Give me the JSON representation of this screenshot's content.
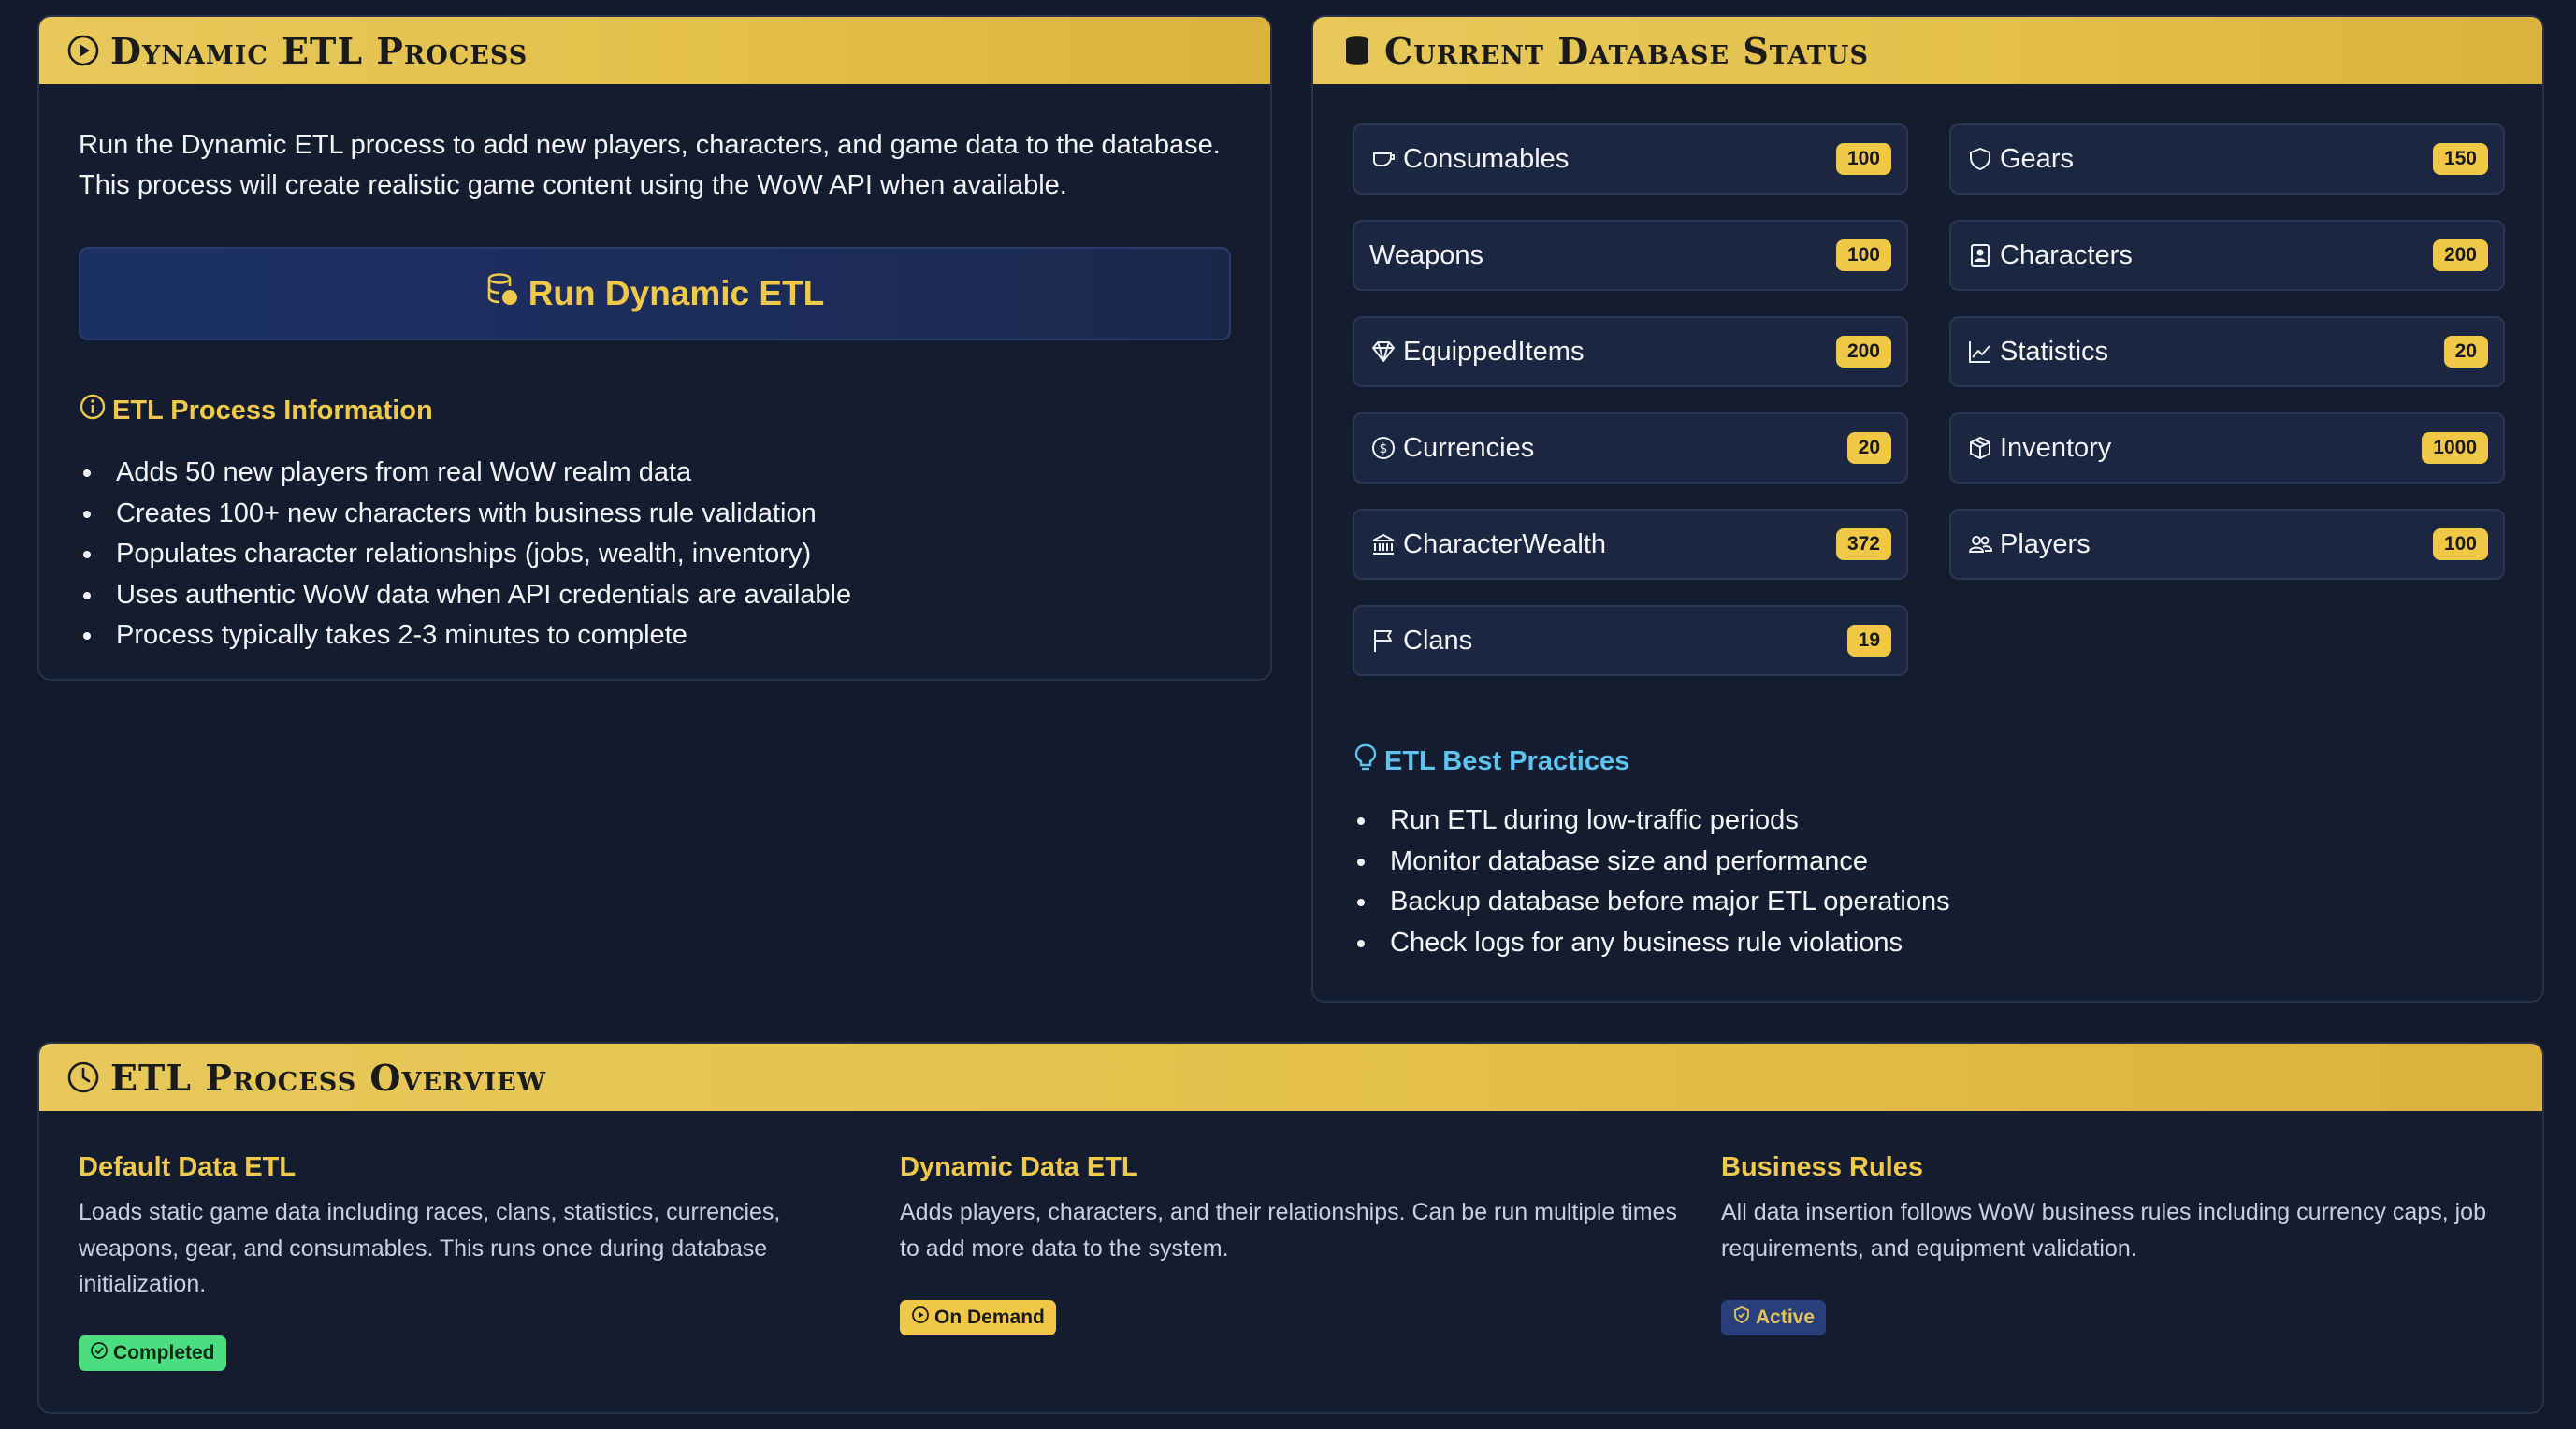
{
  "etl": {
    "title": "Dynamic ETL Process",
    "description": "Run the Dynamic ETL process to add new players, characters, and game data to the database. This process will create realistic game content using the WoW API when available.",
    "run_button": "Run Dynamic ETL",
    "info_title": "ETL Process Information",
    "info_items": [
      "Adds 50 new players from real WoW realm data",
      "Creates 100+ new characters with business rule validation",
      "Populates character relationships (jobs, wealth, inventory)",
      "Uses authentic WoW data when API credentials are available",
      "Process typically takes 2-3 minutes to complete"
    ]
  },
  "db": {
    "title": "Current Database Status",
    "stats": [
      {
        "label": "Consumables",
        "count": "100",
        "icon": "cup-icon"
      },
      {
        "label": "Gears",
        "count": "150",
        "icon": "shield-icon"
      },
      {
        "label": "Weapons",
        "count": "100",
        "icon": ""
      },
      {
        "label": "Characters",
        "count": "200",
        "icon": "id-badge-icon"
      },
      {
        "label": "EquippedItems",
        "count": "200",
        "icon": "gem-icon"
      },
      {
        "label": "Statistics",
        "count": "20",
        "icon": "chart-line-icon"
      },
      {
        "label": "Currencies",
        "count": "20",
        "icon": "coin-icon"
      },
      {
        "label": "Inventory",
        "count": "1000",
        "icon": "box-icon"
      },
      {
        "label": "CharacterWealth",
        "count": "372",
        "icon": "bank-icon"
      },
      {
        "label": "Players",
        "count": "100",
        "icon": "users-icon"
      },
      {
        "label": "Clans",
        "count": "19",
        "icon": "flag-icon"
      }
    ],
    "best_practices_title": "ETL Best Practices",
    "best_practices": [
      "Run ETL during low-traffic periods",
      "Monitor database size and performance",
      "Backup database before major ETL operations",
      "Check logs for any business rule violations"
    ]
  },
  "overview": {
    "title": "ETL Process Overview",
    "columns": [
      {
        "heading": "Default Data ETL",
        "text": "Loads static game data including races, clans, statistics, currencies, weapons, gear, and consumables. This runs once during database initialization.",
        "status": "Completed"
      },
      {
        "heading": "Dynamic Data ETL",
        "text": "Adds players, characters, and their relationships. Can be run multiple times to add more data to the system.",
        "status": "On Demand"
      },
      {
        "heading": "Business Rules",
        "text": "All data insertion follows WoW business rules including currency caps, job requirements, and equipment validation.",
        "status": "Active"
      }
    ]
  },
  "colors": {
    "accent_gold": "#f0c845",
    "header_gold": "#e2bf4a",
    "background": "#121a2b",
    "info_blue": "#5ec4ef",
    "success_green": "#4ade80"
  }
}
